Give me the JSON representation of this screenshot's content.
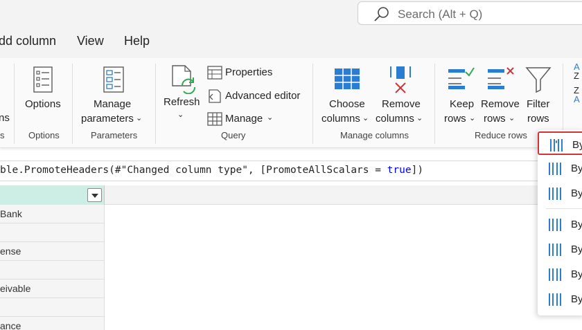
{
  "search": {
    "placeholder": "Search (Alt + Q)"
  },
  "menu": {
    "items": [
      "dd column",
      "View",
      "Help"
    ]
  },
  "ribbon": {
    "partial_left": {
      "label_fragment": "ns",
      "group_fragment": "s"
    },
    "options": {
      "button": "Options",
      "group": "Options"
    },
    "parameters": {
      "button_line1": "Manage",
      "button_line2": "parameters",
      "group": "Parameters"
    },
    "query": {
      "refresh": "Refresh",
      "properties": "Properties",
      "advanced_editor": "Advanced editor",
      "manage": "Manage",
      "group": "Query"
    },
    "manage_columns": {
      "choose_line1": "Choose",
      "choose_line2": "columns",
      "remove_line1": "Remove",
      "remove_line2": "columns",
      "group": "Manage columns"
    },
    "reduce_rows": {
      "keep_line1": "Keep",
      "keep_line2": "rows",
      "remove_line1": "Remove",
      "remove_line2": "rows",
      "filter_line1": "Filter",
      "filter_line2": "rows",
      "group": "Reduce rows"
    },
    "sort": {
      "az_top": "A",
      "az_bottom": "Z",
      "za_top": "Z",
      "za_bottom": "A"
    }
  },
  "formula": {
    "prefix": "ble.PromoteHeaders(#\"Changed column type\", [PromoteAllScalars = ",
    "keyword": "true",
    "suffix": "])"
  },
  "grid": {
    "rows": [
      "Bank",
      "",
      "ense",
      "",
      "eivable",
      "",
      "ance"
    ]
  },
  "dropdown": {
    "items": [
      "By",
      "By",
      "By",
      "By",
      "By",
      "By",
      "By"
    ]
  },
  "colors": {
    "accent_green": "#33a852",
    "accent_red": "#d13438",
    "accent_blue": "#2b7cd3",
    "column_header": "#cdeee4"
  }
}
